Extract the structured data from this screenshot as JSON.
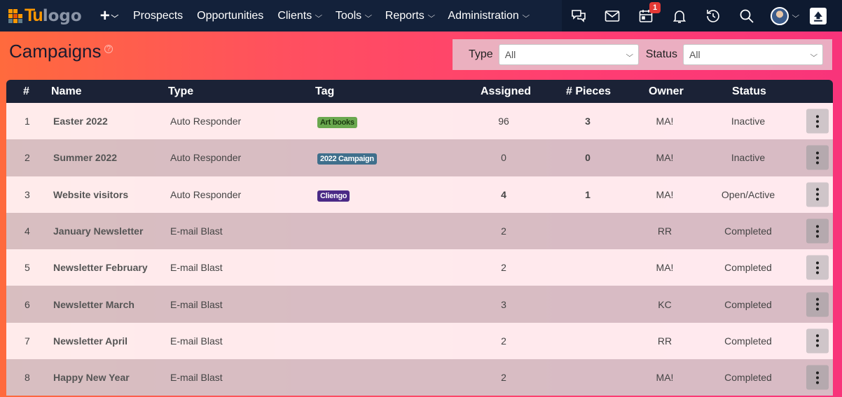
{
  "colors": {
    "nav_bg": "#13213a",
    "nav_right_bg": "#0e1a30",
    "table_header_bg": "#1b2236",
    "badge": "#e53935",
    "logo_accent": "#ff9800"
  },
  "nav": {
    "logo_tu": "Tu",
    "logo_text": "logo",
    "plus_label": "+",
    "items": [
      {
        "label": "Prospects",
        "has_dropdown": false
      },
      {
        "label": "Opportunities",
        "has_dropdown": false
      },
      {
        "label": "Clients",
        "has_dropdown": true
      },
      {
        "label": "Tools",
        "has_dropdown": true
      },
      {
        "label": "Reports",
        "has_dropdown": true
      },
      {
        "label": "Administration",
        "has_dropdown": true
      }
    ],
    "icons": [
      "chat-icon",
      "mail-icon",
      "calendar-icon",
      "bell-icon",
      "history-icon",
      "search-icon",
      "user-avatar",
      "scroll-top-icon"
    ],
    "calendar_badge": "1"
  },
  "page": {
    "title": "Campaigns",
    "help": "?"
  },
  "filters": {
    "type_label": "Type",
    "type_value": "All",
    "status_label": "Status",
    "status_value": "All"
  },
  "table": {
    "columns": [
      "#",
      "Name",
      "Type",
      "Tag",
      "Assigned",
      "# Pieces",
      "Owner",
      "Status"
    ],
    "rows": [
      {
        "num": "1",
        "name": "Easter 2022",
        "type": "Auto Responder",
        "tag": "Art books",
        "tag_color": "#6aa84f",
        "tag_text_color": "#1b3a10",
        "assigned": "96",
        "pieces": "3",
        "owner": "MA!",
        "status": "Inactive"
      },
      {
        "num": "2",
        "name": "Summer 2022",
        "type": "Auto Responder",
        "tag": "2022 Campaign",
        "tag_color": "#3f6f8c",
        "tag_text_color": "#ffffff",
        "assigned": "0",
        "pieces": "0",
        "owner": "MA!",
        "status": "Inactive"
      },
      {
        "num": "3",
        "name": "Website visitors",
        "type": "Auto Responder",
        "tag": "Cliengo",
        "tag_color": "#4b2a86",
        "tag_text_color": "#ffffff",
        "assigned": "4",
        "pieces": "1",
        "owner": "MA!",
        "status": "Open/Active"
      },
      {
        "num": "4",
        "name": "January Newsletter",
        "type": "E-mail Blast",
        "tag": "",
        "assigned": "2",
        "pieces": "",
        "owner": "RR",
        "status": "Completed"
      },
      {
        "num": "5",
        "name": "Newsletter February",
        "type": "E-mail Blast",
        "tag": "",
        "assigned": "2",
        "pieces": "",
        "owner": "MA!",
        "status": "Completed"
      },
      {
        "num": "6",
        "name": "Newsletter March",
        "type": "E-mail Blast",
        "tag": "",
        "assigned": "3",
        "pieces": "",
        "owner": "KC",
        "status": "Completed"
      },
      {
        "num": "7",
        "name": "Newsletter April",
        "type": "E-mail Blast",
        "tag": "",
        "assigned": "2",
        "pieces": "",
        "owner": "RR",
        "status": "Completed"
      },
      {
        "num": "8",
        "name": "Happy New Year",
        "type": "E-mail Blast",
        "tag": "",
        "assigned": "2",
        "pieces": "",
        "owner": "MA!",
        "status": "Completed"
      }
    ]
  }
}
